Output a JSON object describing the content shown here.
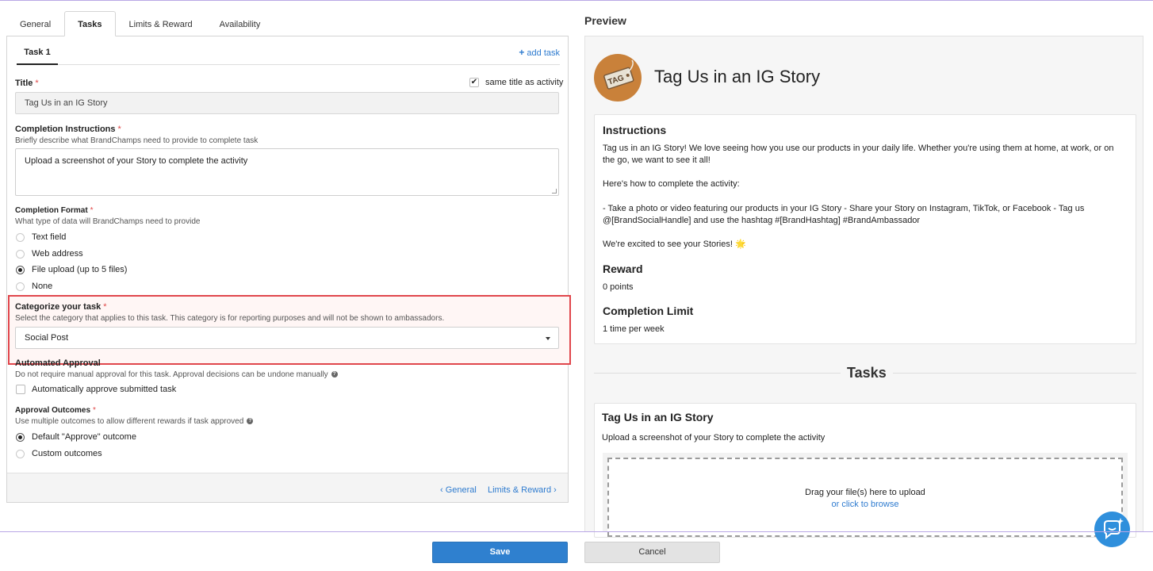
{
  "tabs": [
    "General",
    "Tasks",
    "Limits & Reward",
    "Availability"
  ],
  "subtab": "Task 1",
  "add_task": "add task",
  "title_field": {
    "label": "Title",
    "required": "*",
    "same_title_label": "same title as activity",
    "value": "Tag Us in an IG Story"
  },
  "completion_instructions": {
    "label": "Completion Instructions",
    "required": "*",
    "help": "Briefly describe what BrandChamps need to provide to complete task",
    "value": "Upload a screenshot of your Story to complete the activity"
  },
  "completion_format": {
    "label": "Completion Format",
    "required": "*",
    "help": "What type of data will BrandChamps need to provide",
    "options": [
      "Text field",
      "Web address",
      "File upload (up to 5 files)",
      "None"
    ],
    "selected": "File upload (up to 5 files)"
  },
  "categorize": {
    "label": "Categorize your task",
    "required": "*",
    "help": "Select the category that applies to this task. This category is for reporting purposes and will not be shown to ambassadors.",
    "value": "Social Post"
  },
  "automated_approval": {
    "label": "Automated Approval",
    "help": "Do not require manual approval for this task. Approval decisions can be undone manually",
    "checkbox_label": "Automatically approve submitted task"
  },
  "approval_outcomes": {
    "label": "Approval Outcomes",
    "required": "*",
    "help": "Use multiple outcomes to allow different rewards if task approved",
    "options": [
      "Default \"Approve\" outcome",
      "Custom outcomes"
    ],
    "selected": "Default \"Approve\" outcome"
  },
  "footer_nav": {
    "prev": "General",
    "next": "Limits & Reward"
  },
  "preview": {
    "heading": "Preview",
    "logo_text": "TAG",
    "activity_title": "Tag Us in an IG Story",
    "instructions_heading": "Instructions",
    "instructions_p1": "Tag us in an IG Story! We love seeing how you use our products in your daily life. Whether you're using them at home, at work, or on the go, we want to see it all!",
    "instructions_p2": "Here's how to complete the activity:",
    "instructions_p3": "- Take a photo or video featuring our products in your IG Story - Share your Story on Instagram, TikTok, or Facebook - Tag us @[BrandSocialHandle] and use the hashtag #[BrandHashtag] #BrandAmbassador",
    "instructions_p4": "We're excited to see your Stories! 🌟",
    "reward_heading": "Reward",
    "reward_value": "0 points",
    "limit_heading": "Completion Limit",
    "limit_value": "1 time per week",
    "tasks_heading": "Tasks",
    "task_title": "Tag Us in an IG Story",
    "task_instructions": "Upload a screenshot of your Story to complete the activity",
    "drop_text": "Drag your file(s) here to upload",
    "browse_text": "or click to browse"
  },
  "buttons": {
    "save": "Save",
    "cancel": "Cancel"
  },
  "colors": {
    "accent": "#2f80cf",
    "link": "#2e7bcf",
    "highlight_border": "#e0464c",
    "required": "#e04848"
  }
}
